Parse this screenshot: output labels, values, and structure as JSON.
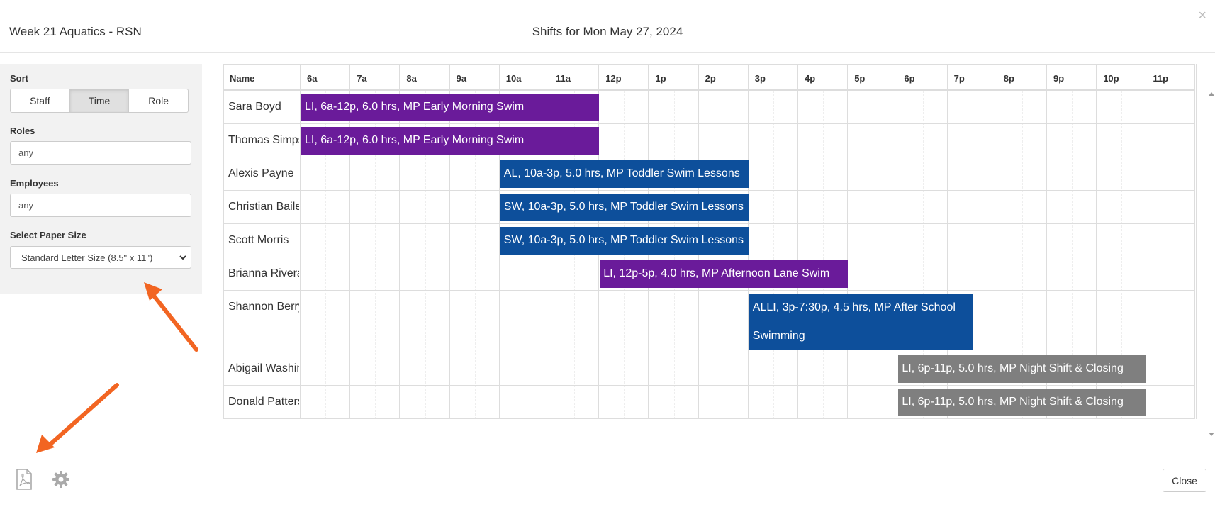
{
  "header": {
    "title": "Week 21 Aquatics - RSN",
    "center_title": "Shifts for Mon May 27, 2024",
    "close_icon": "×"
  },
  "sidebar": {
    "sort_label": "Sort",
    "sort_options": [
      "Staff",
      "Time",
      "Role"
    ],
    "sort_selected": "Time",
    "roles_label": "Roles",
    "roles_value": "any",
    "employees_label": "Employees",
    "employees_value": "any",
    "paper_label": "Select Paper Size",
    "paper_value": "Standard Letter Size (8.5\" x 11\")"
  },
  "grid": {
    "name_header": "Name",
    "hours": [
      "6a",
      "7a",
      "8a",
      "9a",
      "10a",
      "11a",
      "12p",
      "1p",
      "2p",
      "3p",
      "4p",
      "5p",
      "6p",
      "7p",
      "8p",
      "9p",
      "10p",
      "11p"
    ],
    "rows": [
      {
        "name": "Sara Boyd",
        "shift": "LI, 6a-12p, 6.0 hrs, MP Early Morning Swim",
        "start": 6,
        "end": 12,
        "color": "#6a1b9a"
      },
      {
        "name": "Thomas Simpson",
        "shift": "LI, 6a-12p, 6.0 hrs, MP Early Morning Swim",
        "start": 6,
        "end": 12,
        "color": "#6a1b9a"
      },
      {
        "name": "Alexis Payne",
        "shift": "AL, 10a-3p, 5.0 hrs, MP Toddler Swim Lessons",
        "start": 10,
        "end": 15,
        "color": "#0d4f9b"
      },
      {
        "name": "Christian Bailey",
        "shift": "SW, 10a-3p, 5.0 hrs, MP Toddler Swim Lessons",
        "start": 10,
        "end": 15,
        "color": "#0d4f9b"
      },
      {
        "name": "Scott Morris",
        "shift": "SW, 10a-3p, 5.0 hrs, MP Toddler Swim Lessons",
        "start": 10,
        "end": 15,
        "color": "#0d4f9b"
      },
      {
        "name": "Brianna Rivera",
        "shift": "LI, 12p-5p, 4.0 hrs, MP Afternoon Lane Swim",
        "start": 12,
        "end": 17,
        "color": "#6a1b9a"
      },
      {
        "name": "Shannon Berry",
        "shift": "ALLI, 3p-7:30p, 4.5 hrs, MP After School Swimming",
        "start": 15,
        "end": 19.5,
        "color": "#0d4f9b"
      },
      {
        "name": "Abigail Washington",
        "shift": "LI, 6p-11p, 5.0 hrs, MP Night Shift & Closing",
        "start": 18,
        "end": 23,
        "color": "#7f7f7f"
      },
      {
        "name": "Donald Patterson",
        "shift": "LI, 6p-11p, 5.0 hrs, MP Night Shift & Closing",
        "start": 18,
        "end": 23,
        "color": "#7f7f7f"
      }
    ]
  },
  "footer": {
    "pdf_icon": "pdf-file-icon",
    "settings_icon": "gear-icon",
    "close_label": "Close"
  },
  "colors": {
    "purple": "#6a1b9a",
    "blue": "#0d4f9b",
    "gray": "#7f7f7f",
    "arrow": "#f26522"
  }
}
